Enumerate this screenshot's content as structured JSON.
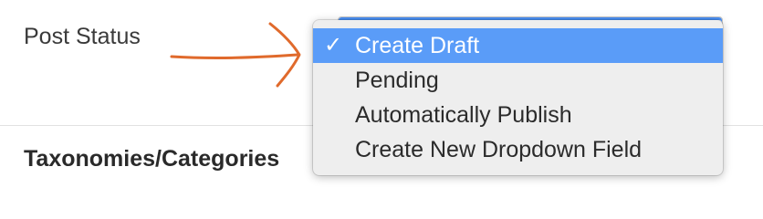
{
  "form": {
    "post_status_label": "Post Status",
    "taxonomies_heading": "Taxonomies/Categories"
  },
  "dropdown": {
    "selected_value": "Create Draft",
    "check_mark": "✓",
    "options": [
      {
        "label": "Create Draft",
        "selected": true
      },
      {
        "label": "Pending",
        "selected": false
      },
      {
        "label": "Automatically Publish",
        "selected": false
      },
      {
        "label": "Create New Dropdown Field",
        "selected": false
      }
    ]
  },
  "colors": {
    "selected_highlight": "#5a9cf8",
    "annotation_arrow": "#e06a2c"
  }
}
